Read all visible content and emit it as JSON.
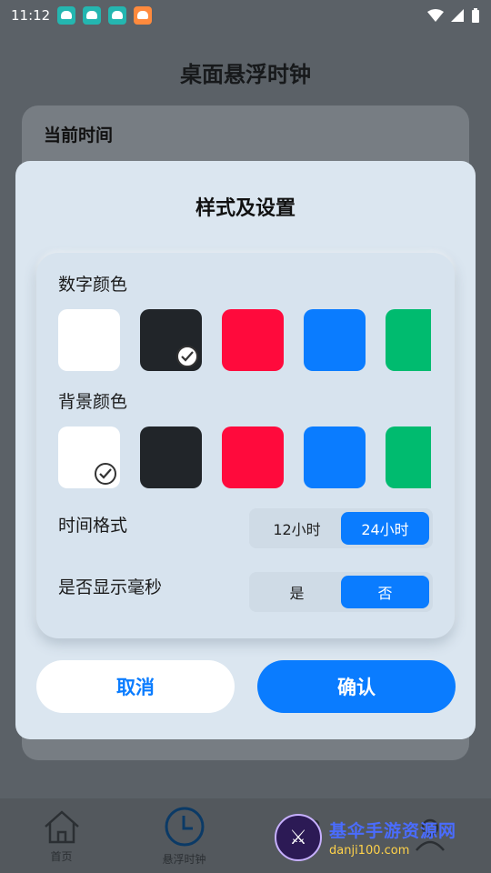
{
  "status": {
    "time": "11:12"
  },
  "page": {
    "title": "桌面悬浮时钟",
    "current_time_label": "当前时间"
  },
  "nav": [
    {
      "label": "首页",
      "icon": "home-icon"
    },
    {
      "label": "悬浮时钟",
      "icon": "clock-icon"
    },
    {
      "label": "",
      "icon": "tab3-icon"
    },
    {
      "label": "",
      "icon": "profile-icon"
    }
  ],
  "dialog": {
    "title": "样式及设置",
    "digit_color_label": "数字颜色",
    "bg_color_label": "背景颜色",
    "time_format_label": "时间格式",
    "time_format_options": [
      "12小时",
      "24小时"
    ],
    "time_format_selected": "24小时",
    "ms_label": "是否显示毫秒",
    "ms_options": [
      "是",
      "否"
    ],
    "ms_selected": "否",
    "cancel": "取消",
    "confirm": "确认"
  },
  "colors": {
    "swatches": [
      "#ffffff",
      "#212529",
      "#ff0a3c",
      "#0a7cff",
      "#00bb6f"
    ],
    "digit_selected": "#212529",
    "bg_selected": "#ffffff",
    "accent": "#0a7cff"
  },
  "watermark": {
    "title": "基伞手游资源网",
    "url": "danji100.com"
  }
}
